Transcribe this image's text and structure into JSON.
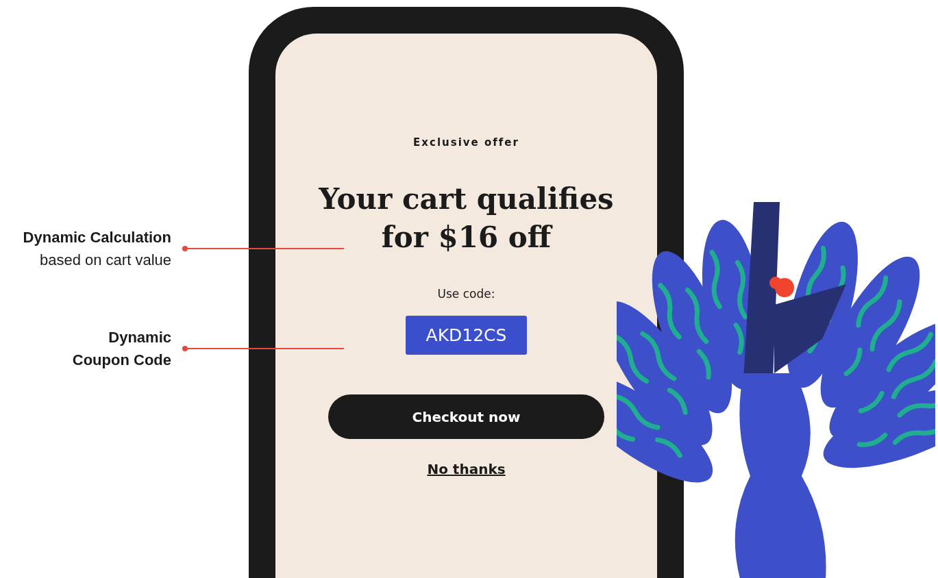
{
  "annotations": [
    {
      "title": "Dynamic Calculation",
      "subtitle": "based on cart value"
    },
    {
      "title": "Dynamic Coupon Code"
    }
  ],
  "screen": {
    "eyebrow": "Exclusive offer",
    "headline": "Your cart qualifies for $16 off",
    "code_label": "Use code:",
    "coupon_code": "AKD12CS",
    "primary_button": "Checkout now",
    "secondary_link": "No thanks"
  }
}
